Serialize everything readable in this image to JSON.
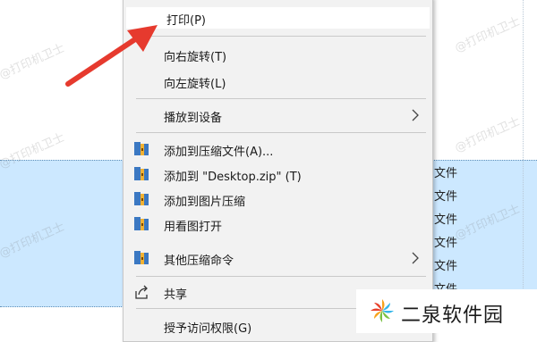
{
  "explorer": {
    "type_cells": [
      "文件",
      "文件",
      "文件",
      "文件",
      "文件",
      "文件"
    ]
  },
  "menu": {
    "print": "打印(P)",
    "rotate_right": "向右旋转(T)",
    "rotate_left": "向左旋转(L)",
    "cast_to_device": "播放到设备",
    "add_to_archive": "添加到压缩文件(A)...",
    "add_to_zip": "添加到 \"Desktop.zip\" (T)",
    "add_to_image_compress": "添加到图片压缩",
    "open_with_viewer": "用看图打开",
    "other_compress_commands": "其他压缩命令",
    "share": "共享",
    "grant_access": "授予访问权限(G)"
  },
  "watermark": {
    "text": "@打印机卫士"
  },
  "brand": {
    "name": "二泉软件园",
    "colors": [
      "#f7a21b",
      "#35b6e9",
      "#7ac143",
      "#e8412c"
    ]
  },
  "colors": {
    "selection": "#cce8ff",
    "menu_bg": "#f2f2f2",
    "arrow": "#e63a2e"
  }
}
